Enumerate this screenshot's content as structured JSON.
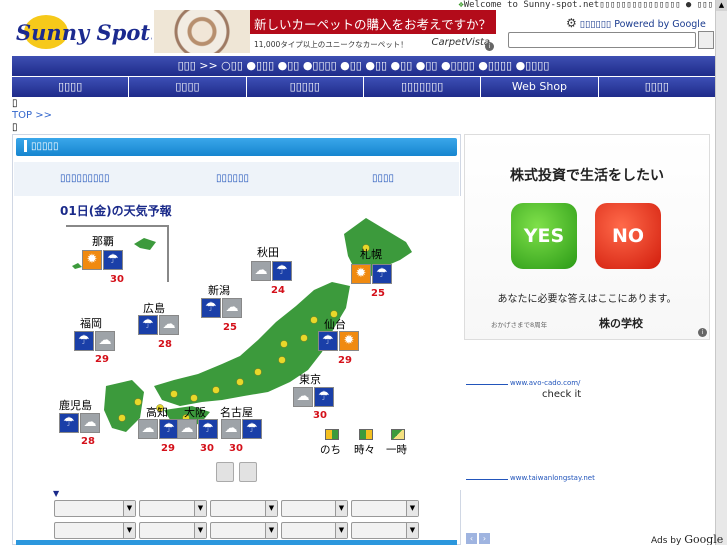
{
  "header": {
    "logo_text": "Sunny Spot!",
    "welcome_text": "Welcome to Sunny-spot.net▯▯▯▯▯▯▯▯▯▯▯▯▯▯▯ ● ▯▯▯",
    "settings_label": "▯▯▯▯▯▯",
    "powered_by": "Powered by Google",
    "search_placeholder": ""
  },
  "banner": {
    "headline": "新しいカーペットの購入をお考えですか？",
    "subline": "11,000タイプ以上のユニークなカーペット！",
    "brand": "CarpetVista",
    "info_icon": "i"
  },
  "crumbbar_text": "▯▯▯ >> ○▯▯ ●▯▯▯ ●▯▯ ●▯▯▯▯ ●▯▯ ●▯▯ ●▯▯ ●▯▯ ●▯▯▯▯ ●▯▯▯▯ ●▯▯▯▯",
  "nav": [
    "▯▯▯▯",
    "▯▯▯▯",
    "▯▯▯▯▯",
    "▯▯▯▯▯▯▯",
    "Web Shop",
    "▯▯▯▯"
  ],
  "box1": "▯",
  "top_link": "TOP >>",
  "box2": "▯",
  "section_title": "▯▯▯▯▯",
  "tabs": [
    "▯▯▯▯▯▯▯▯▯",
    "▯▯▯▯▯▯",
    "▯▯▯▯"
  ],
  "weather": {
    "title": "01日(金)の天気予報",
    "cities": [
      {
        "name": "那覇",
        "temp": "30",
        "icons": [
          "sun",
          "rain"
        ]
      },
      {
        "name": "秋田",
        "temp": "24",
        "icons": [
          "cloud",
          "rain"
        ]
      },
      {
        "name": "札幌",
        "temp": "25",
        "icons": [
          "sun",
          "rain"
        ]
      },
      {
        "name": "新潟",
        "temp": "25",
        "icons": [
          "rain",
          "cloud"
        ]
      },
      {
        "name": "広島",
        "temp": "28",
        "icons": [
          "rain",
          "cloud"
        ]
      },
      {
        "name": "福岡",
        "temp": "29",
        "icons": [
          "rain",
          "cloud"
        ]
      },
      {
        "name": "仙台",
        "temp": "29",
        "icons": [
          "rain",
          "sun"
        ]
      },
      {
        "name": "東京",
        "temp": "30",
        "icons": [
          "cloud",
          "rain"
        ]
      },
      {
        "name": "鹿児島",
        "temp": "28",
        "icons": [
          "rain",
          "cloud"
        ]
      },
      {
        "name": "高知",
        "temp": "29",
        "icons": [
          "cloud",
          "rain"
        ]
      },
      {
        "name": "大阪",
        "temp": "30",
        "icons": [
          "cloud",
          "rain"
        ]
      },
      {
        "name": "名古屋",
        "temp": "30",
        "icons": [
          "cloud",
          "rain"
        ]
      }
    ],
    "legend": [
      "のち",
      "時々",
      "一時"
    ],
    "map_color": "#3c9a3c",
    "city_dot_color": "#e8d82a"
  },
  "selects_marker": "▼",
  "ad": {
    "question": "株式投資で生活をしたい",
    "yes": "YES",
    "no": "NO",
    "answer": "あなたに必要な答えはここにあります。",
    "foot_small": "おかげさまで8周年",
    "foot_brand": "株の学校",
    "info_icon": "i"
  },
  "right_links": [
    {
      "url": "www.avo-cado.com/",
      "desc": "check it"
    },
    {
      "url": "www.taiwanlongstay.net",
      "desc": ""
    }
  ],
  "ads_by": "Ads by",
  "google": "Google",
  "pager": [
    "‹",
    "›"
  ]
}
